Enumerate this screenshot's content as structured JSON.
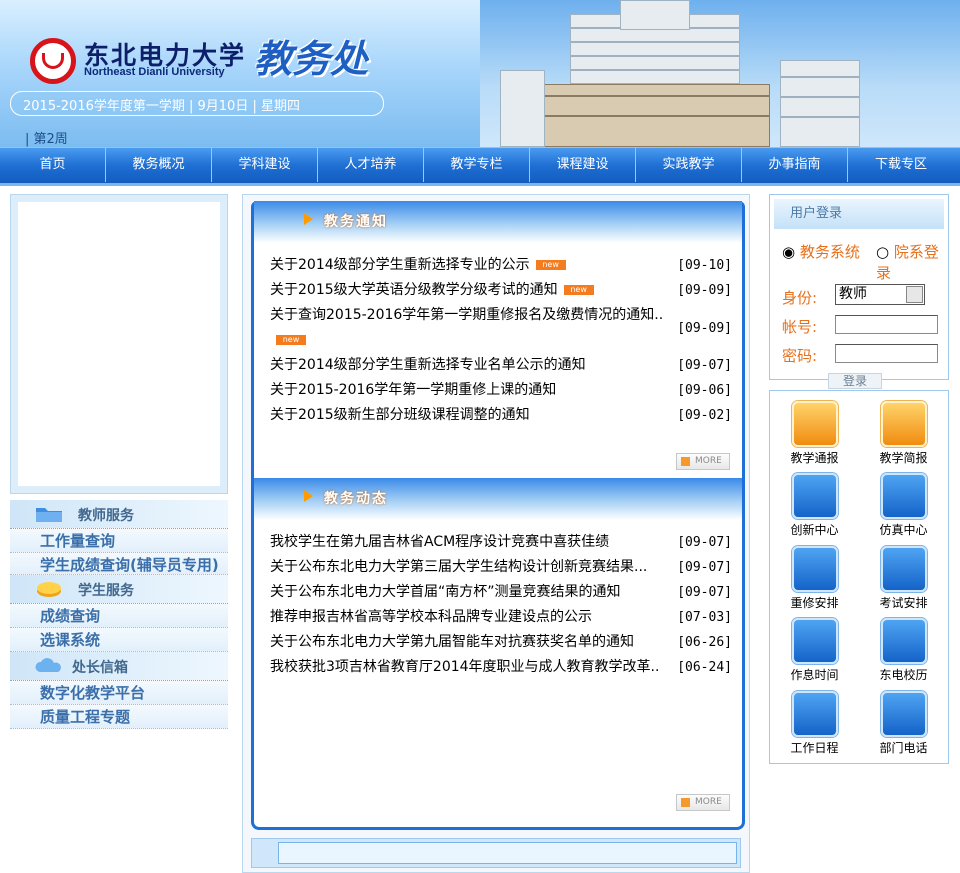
{
  "header": {
    "school_cn": "东北电力大学",
    "school_en": "Northeast Dianli University",
    "dept": "教务处",
    "date_line": "2015-2016学年度第一学期 | 9月10日 | 星期四",
    "week": "| 第2周"
  },
  "nav": [
    "首页",
    "教务概况",
    "学科建设",
    "人才培养",
    "教学专栏",
    "课程建设",
    "实践教学",
    "办事指南",
    "下载专区"
  ],
  "left": {
    "teacher_title": "教师服务",
    "teacher_links": [
      "工作量查询",
      "学生成绩查询(辅导员专用)"
    ],
    "student_title": "学生服务",
    "student_links": [
      "成绩查询",
      "选课系统"
    ],
    "mail_title": "处长信箱",
    "mail_links": [
      "数字化教学平台",
      "质量工程专题"
    ]
  },
  "notice": {
    "title": "教务通知",
    "items": [
      {
        "text": "关于2014级部分学生重新选择专业的公示",
        "new": true,
        "date": "[09-10]"
      },
      {
        "text": "关于2015级大学英语分级教学分级考试的通知",
        "new": true,
        "date": "[09-09]"
      },
      {
        "text": "关于查询2015-2016学年第一学期重修报名及缴费情况的通知..",
        "new": true,
        "date": "[09-09]"
      },
      {
        "text": "关于2014级部分学生重新选择专业名单公示的通知",
        "new": false,
        "date": "[09-07]"
      },
      {
        "text": "关于2015-2016学年第一学期重修上课的通知",
        "new": false,
        "date": "[09-06]"
      },
      {
        "text": "关于2015级新生部分班级课程调整的通知",
        "new": false,
        "date": "[09-02]"
      }
    ],
    "more": "MORE"
  },
  "news": {
    "title": "教务动态",
    "items": [
      {
        "text": "我校学生在第九届吉林省ACM程序设计竞赛中喜获佳绩",
        "date": "[09-07]"
      },
      {
        "text": "关于公布东北电力大学第三届大学生结构设计创新竞赛结果...",
        "date": "[09-07]"
      },
      {
        "text": "关于公布东北电力大学首届“南方杯”测量竞赛结果的通知",
        "date": "[09-07]"
      },
      {
        "text": "推荐申报吉林省高等学校本科品牌专业建设点的公示",
        "date": "[07-03]"
      },
      {
        "text": "关于公布东北电力大学第九届智能车对抗赛获奖名单的通知",
        "date": "[06-26]"
      },
      {
        "text": "我校获批3项吉林省教育厅2014年度职业与成人教育教学改革..",
        "date": "[06-24]"
      }
    ],
    "more": "MORE"
  },
  "new_tag": "new",
  "login": {
    "title": "用户登录",
    "radio1": "教务系统",
    "radio2": "院系登录",
    "role_label": "身份:",
    "role_value": "教师",
    "account_label": "帐号:",
    "password_label": "密码:",
    "submit": "登录"
  },
  "quick": [
    "教学通报",
    "教学简报",
    "创新中心",
    "仿真中心",
    "重修安排",
    "考试安排",
    "作息时间",
    "东电校历",
    "工作日程",
    "部门电话"
  ]
}
